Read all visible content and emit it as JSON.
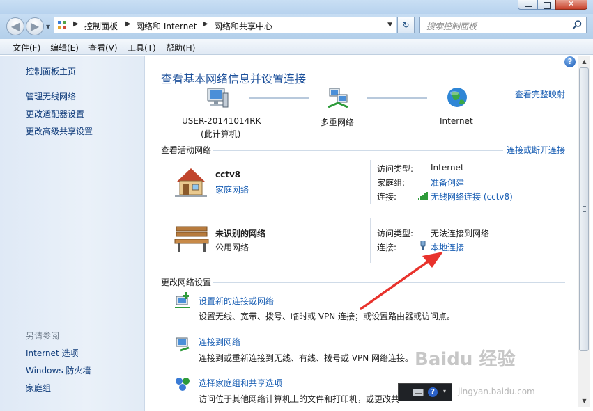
{
  "colors": {
    "link": "#1a5fb4",
    "title": "#1b4f9a",
    "arrow": "#e8322c"
  },
  "breadcrumb": [
    "控制面板",
    "网络和 Internet",
    "网络和共享中心"
  ],
  "search": {
    "placeholder": "搜索控制面板"
  },
  "menu": [
    "文件(F)",
    "编辑(E)",
    "查看(V)",
    "工具(T)",
    "帮助(H)"
  ],
  "left_nav": {
    "items": [
      "控制面板主页",
      "管理无线网络",
      "更改适配器设置",
      "更改高级共享设置"
    ],
    "see_also_title": "另请参阅",
    "see_also": [
      "Internet 选项",
      "Windows 防火墙",
      "家庭组"
    ]
  },
  "main": {
    "title": "查看基本网络信息并设置连接",
    "view_map": "查看完整映射",
    "map": {
      "computer_name": "USER-20141014RK",
      "computer_sub": "(此计算机)",
      "middle": "多重网络",
      "right": "Internet"
    },
    "active_header": "查看活动网络",
    "connect_disconnect": "连接或断开连接",
    "networks": [
      {
        "name": "cctv8",
        "type": "家庭网络",
        "access_label": "访问类型:",
        "access_value": "Internet",
        "homegroup_label": "家庭组:",
        "homegroup_value": "准备创建",
        "conn_label": "连接:",
        "conn_value": "无线网络连接 (cctv8)"
      },
      {
        "name": "未识别的网络",
        "type": "公用网络",
        "access_label": "访问类型:",
        "access_value": "无法连接到网络",
        "conn_label": "连接:",
        "conn_value": "本地连接"
      }
    ],
    "change_header": "更改网络设置",
    "tasks": [
      {
        "title": "设置新的连接或网络",
        "desc": "设置无线、宽带、拨号、临时或 VPN 连接；或设置路由器或访问点。"
      },
      {
        "title": "连接到网络",
        "desc": "连接到或重新连接到无线、有线、拨号或 VPN 网络连接。"
      },
      {
        "title": "选择家庭组和共享选项",
        "desc": "访问位于其他网络计算机上的文件和打印机，或更改共"
      }
    ]
  },
  "watermark": {
    "brand": "Baidu 经验",
    "url": "jingyan.baidu.com"
  }
}
